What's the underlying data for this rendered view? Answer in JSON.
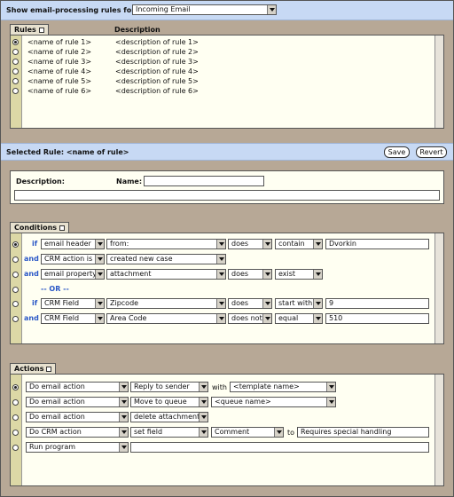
{
  "header": {
    "label": "Show email-processing rules for:",
    "selected": "Incoming Email"
  },
  "rules": {
    "tab": "Rules",
    "description_header": "Description",
    "items": [
      {
        "name": "<name of rule 1>",
        "description": "<description of rule 1>"
      },
      {
        "name": "<name of rule 2>",
        "description": "<description of rule 2>"
      },
      {
        "name": "<name of rule 3>",
        "description": "<description of rule 3>"
      },
      {
        "name": "<name of rule 4>",
        "description": "<description of rule 4>"
      },
      {
        "name": "<name of rule 5>",
        "description": "<description of rule 5>"
      },
      {
        "name": "<name of rule 6>",
        "description": "<description of rule 6>"
      }
    ]
  },
  "selected_rule": {
    "title": "Selected Rule: <name of rule>",
    "save": "Save",
    "revert": "Revert"
  },
  "description": {
    "label": "Description:",
    "name_label": "Name:",
    "name_value": "",
    "desc_value": ""
  },
  "conditions": {
    "tab": "Conditions",
    "if": "if",
    "and": "and",
    "or": "-- OR --",
    "rows": [
      {
        "field": "email header",
        "sub": "from:",
        "verb": "does",
        "op": "contain",
        "value": "Dvorkin"
      },
      {
        "field": "CRM action is",
        "sub": "created new case"
      },
      {
        "field": "email property",
        "sub": "attachment",
        "verb": "does",
        "op": "exist"
      },
      {
        "field": "CRM Field",
        "sub": "Zipcode",
        "verb": "does",
        "op": "start with",
        "value": "9"
      },
      {
        "field": "CRM Field",
        "sub": "Area Code",
        "verb": "does not",
        "op": "equal",
        "value": "510"
      }
    ]
  },
  "actions": {
    "tab": "Actions",
    "with": "with",
    "to": "to",
    "rows": [
      {
        "action": "Do email action",
        "sub": "Reply to sender",
        "target": "<template name>"
      },
      {
        "action": "Do email action",
        "sub": "Move to queue",
        "target": "<queue name>"
      },
      {
        "action": "Do email action",
        "sub": "delete attachment"
      },
      {
        "action": "Do CRM action",
        "sub": "set field",
        "target": "Comment",
        "value": "Requires special handling"
      },
      {
        "action": "Run program",
        "value": ""
      }
    ]
  }
}
